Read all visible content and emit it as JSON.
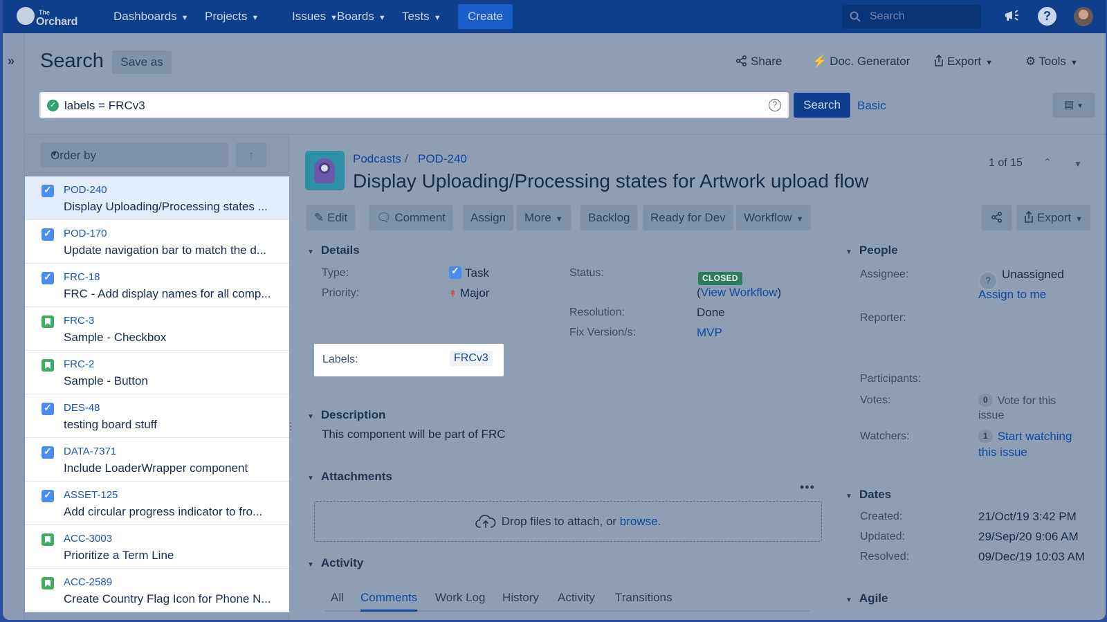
{
  "nav": {
    "logo_small": "The",
    "logo_main": "Orchard",
    "items": [
      "Dashboards",
      "Projects",
      "Issues",
      "Boards",
      "Tests"
    ],
    "create": "Create",
    "search_placeholder": "Search"
  },
  "header": {
    "title": "Search",
    "save_as": "Save as",
    "share": "Share",
    "doc_generator": "Doc. Generator",
    "export": "Export",
    "tools": "Tools"
  },
  "jql": {
    "query": "labels = FRCv3",
    "search_button": "Search",
    "basic_link": "Basic"
  },
  "list": {
    "order_by": "Order by",
    "issues": [
      {
        "key": "POD-240",
        "summary": "Display Uploading/Processing states ...",
        "type": "task"
      },
      {
        "key": "POD-170",
        "summary": "Update navigation bar to match the d...",
        "type": "task"
      },
      {
        "key": "FRC-18",
        "summary": "FRC - Add display names for all comp...",
        "type": "task"
      },
      {
        "key": "FRC-3",
        "summary": "Sample - Checkbox",
        "type": "story"
      },
      {
        "key": "FRC-2",
        "summary": "Sample - Button",
        "type": "story"
      },
      {
        "key": "DES-48",
        "summary": "testing board stuff",
        "type": "task"
      },
      {
        "key": "DATA-7371",
        "summary": "Include LoaderWrapper component",
        "type": "task"
      },
      {
        "key": "ASSET-125",
        "summary": "Add circular progress indicator to fro...",
        "type": "task"
      },
      {
        "key": "ACC-3003",
        "summary": "Prioritize a Term Line",
        "type": "story"
      },
      {
        "key": "ACC-2589",
        "summary": "Create Country Flag Icon for Phone N...",
        "type": "story"
      }
    ]
  },
  "issue": {
    "project": "Podcasts",
    "key": "POD-240",
    "title": "Display Uploading/Processing states for Artwork upload flow",
    "pager": "1 of 15",
    "toolbar": {
      "edit": "Edit",
      "comment": "Comment",
      "assign": "Assign",
      "more": "More",
      "backlog": "Backlog",
      "ready": "Ready for Dev",
      "workflow": "Workflow",
      "export": "Export"
    },
    "details": {
      "heading": "Details",
      "type_label": "Type:",
      "type_value": "Task",
      "priority_label": "Priority:",
      "priority_value": "Major",
      "status_label": "Status:",
      "status_value": "CLOSED",
      "view_workflow_open": "(",
      "view_workflow": "View Workflow",
      "view_workflow_close": ")",
      "resolution_label": "Resolution:",
      "resolution_value": "Done",
      "fix_label": "Fix Version/s:",
      "fix_value": "MVP",
      "labels_label": "Labels:",
      "labels_value": "FRCv3"
    },
    "description": {
      "heading": "Description",
      "text": "This component will be part of FRC"
    },
    "attachments": {
      "heading": "Attachments",
      "drop_text": "Drop files to attach, or ",
      "browse": "browse",
      "period": "."
    },
    "activity": {
      "heading": "Activity",
      "tabs": [
        "All",
        "Comments",
        "Work Log",
        "History",
        "Activity",
        "Transitions"
      ],
      "active_tab": "Comments"
    },
    "people": {
      "heading": "People",
      "assignee_label": "Assignee:",
      "assignee_value": "Unassigned",
      "assign_to_me": "Assign to me",
      "reporter_label": "Reporter:",
      "participants_label": "Participants:",
      "votes_label": "Votes:",
      "votes_count": "0",
      "vote_text_1": "Vote for this",
      "vote_text_2": "issue",
      "watchers_label": "Watchers:",
      "watchers_count": "1",
      "watch_text_1": "Start watching",
      "watch_text_2": "this issue"
    },
    "dates": {
      "heading": "Dates",
      "created_label": "Created:",
      "created_value": "21/Oct/19 3:42 PM",
      "updated_label": "Updated:",
      "updated_value": "29/Sep/20 9:06 AM",
      "resolved_label": "Resolved:",
      "resolved_value": "09/Dec/19 10:03 AM"
    },
    "agile": {
      "heading": "Agile"
    }
  }
}
